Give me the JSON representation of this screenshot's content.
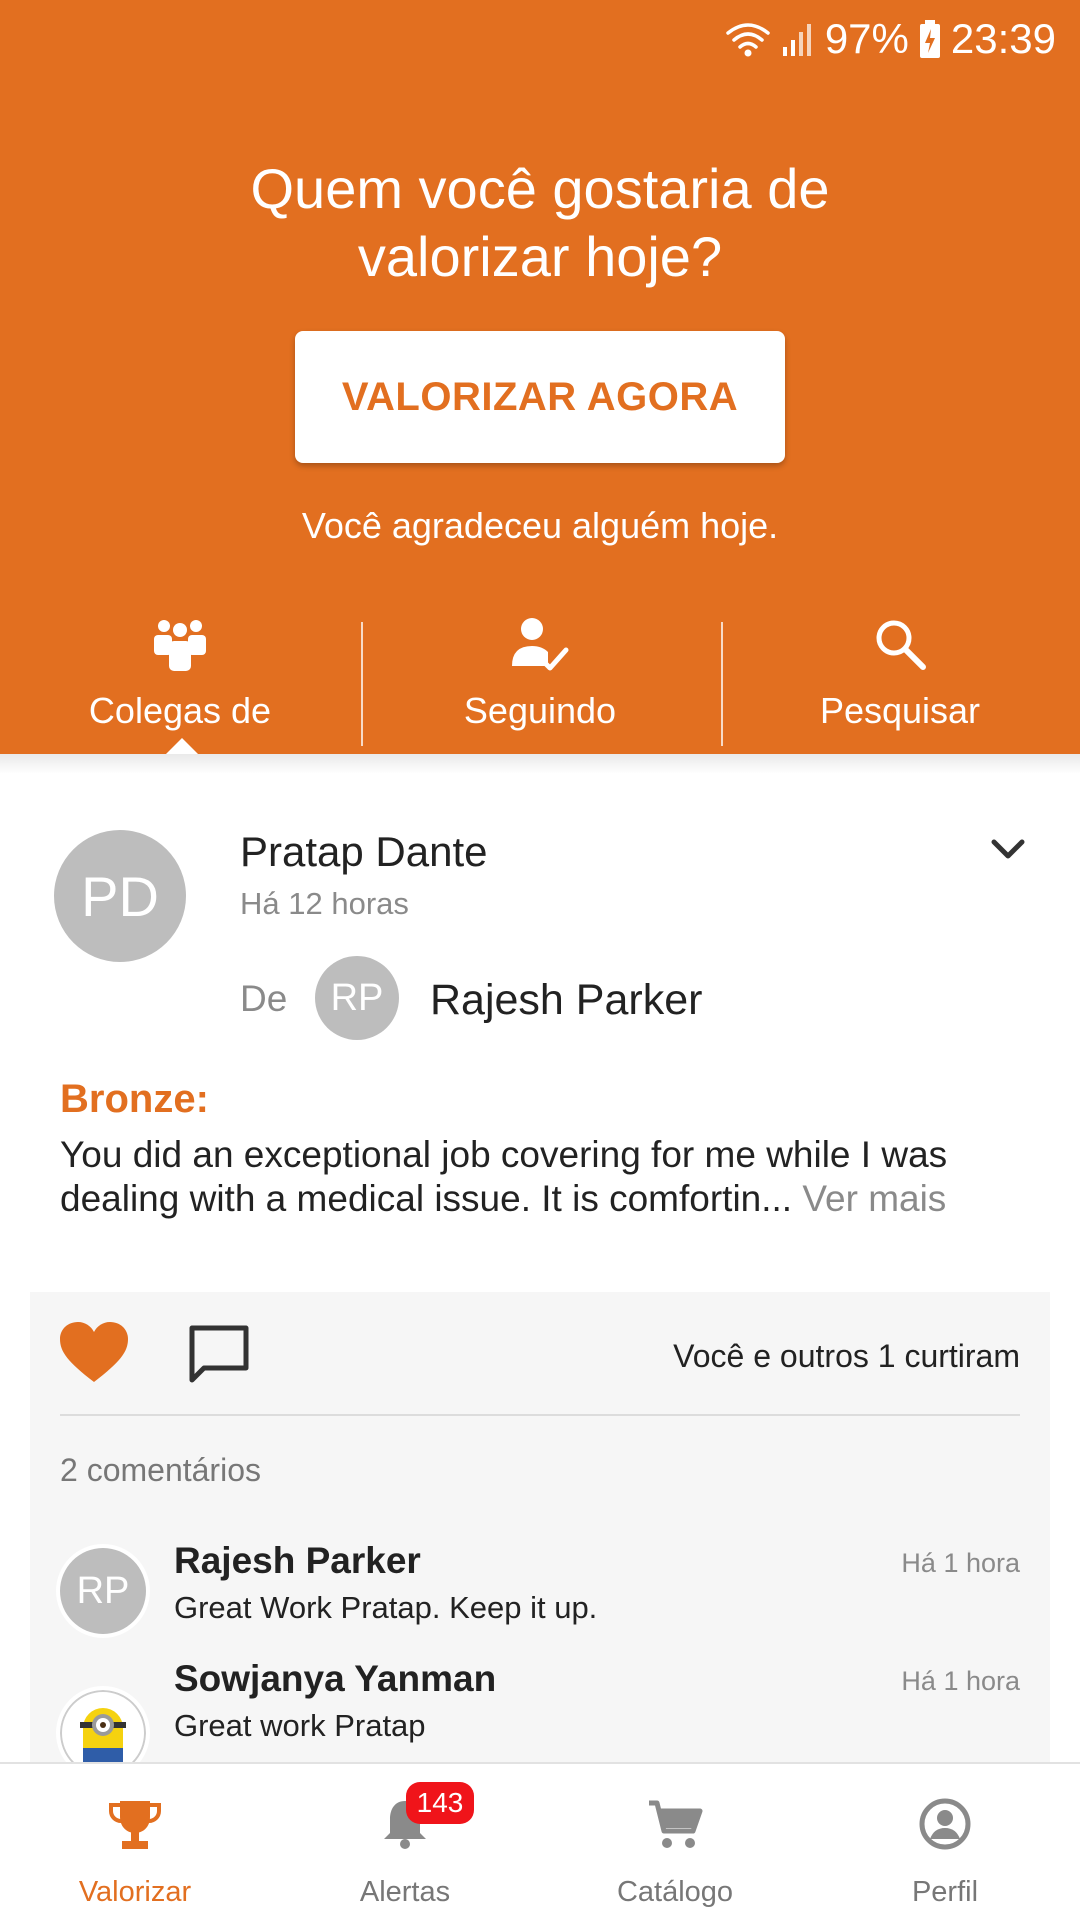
{
  "status_bar": {
    "battery": "97%",
    "time": "23:39"
  },
  "header": {
    "headline_line1": "Quem você gostaria de",
    "headline_line2": "valorizar hoje?",
    "cta_label": "VALORIZAR AGORA",
    "thanks_text": "Você agradeceu alguém hoje."
  },
  "feed_tabs": [
    {
      "label": "Colegas de",
      "icon": "group-icon",
      "selected": true
    },
    {
      "label": "Seguindo",
      "icon": "person-check-icon",
      "selected": false
    },
    {
      "label": "Pesquisar",
      "icon": "search-icon",
      "selected": false
    }
  ],
  "post": {
    "avatar_initials": "PD",
    "recipient_name": "Pratap Dante",
    "time": "Há 12 horas",
    "from_label": "De",
    "sender_initials": "RP",
    "sender_name": "Rajesh Parker",
    "award_label": "Bronze:",
    "message": "You did an exceptional job covering for me while I was dealing with a medical issue. It is comfortin...",
    "see_more": "Ver mais",
    "likes_text": "Você e outros 1 curtiram",
    "comments_count": "2 comentários",
    "comments": [
      {
        "initials": "RP",
        "name": "Rajesh Parker",
        "text": "Great Work Pratap. Keep it up.",
        "time": "Há 1 hora"
      },
      {
        "name": "Sowjanya Yanman",
        "text": "Great work Pratap",
        "time": "Há 1 hora"
      }
    ]
  },
  "bottom_nav": [
    {
      "label": "Valorizar",
      "icon": "trophy-icon",
      "active": true
    },
    {
      "label": "Alertas",
      "icon": "bell-icon",
      "active": false,
      "badge": "143"
    },
    {
      "label": "Catálogo",
      "icon": "cart-icon",
      "active": false
    },
    {
      "label": "Perfil",
      "icon": "profile-icon",
      "active": false
    }
  ],
  "colors": {
    "accent": "#E26F20",
    "badge": "#F0141A",
    "avatar_gray": "#BDBDBD"
  }
}
